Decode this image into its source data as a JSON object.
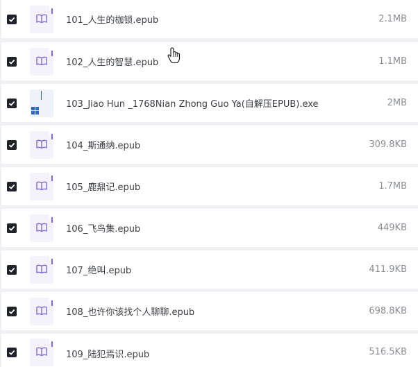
{
  "files": [
    {
      "name": "101_人生的枷锁.epub",
      "size": "2.1MB",
      "icon": "ebook-icon",
      "checked": true
    },
    {
      "name": "102_人生的智慧.epub",
      "size": "1.1MB",
      "icon": "ebook-icon",
      "checked": true
    },
    {
      "name": "103_Jiao Hun _1768Nian Zhong Guo Ya(自解压EPUB).exe",
      "size": "2MB",
      "icon": "exe-icon",
      "checked": true
    },
    {
      "name": "104_斯通纳.epub",
      "size": "309.8KB",
      "icon": "ebook-icon",
      "checked": true
    },
    {
      "name": "105_鹿鼎记.epub",
      "size": "1.7MB",
      "icon": "ebook-icon",
      "checked": true
    },
    {
      "name": "106_飞鸟集.epub",
      "size": "449KB",
      "icon": "ebook-icon",
      "checked": true
    },
    {
      "name": "107_绝叫.epub",
      "size": "411.9KB",
      "icon": "ebook-icon",
      "checked": true
    },
    {
      "name": "108_也许你该找个人聊聊.epub",
      "size": "698.8KB",
      "icon": "ebook-icon",
      "checked": true
    },
    {
      "name": "109_陆犯焉识.epub",
      "size": "516.5KB",
      "icon": "ebook-icon",
      "checked": true
    }
  ],
  "colors": {
    "accent": "#7a6cd6",
    "checkbox": "#1f2329",
    "row_bg": "#ffffff",
    "page_bg": "#eef0f4"
  }
}
